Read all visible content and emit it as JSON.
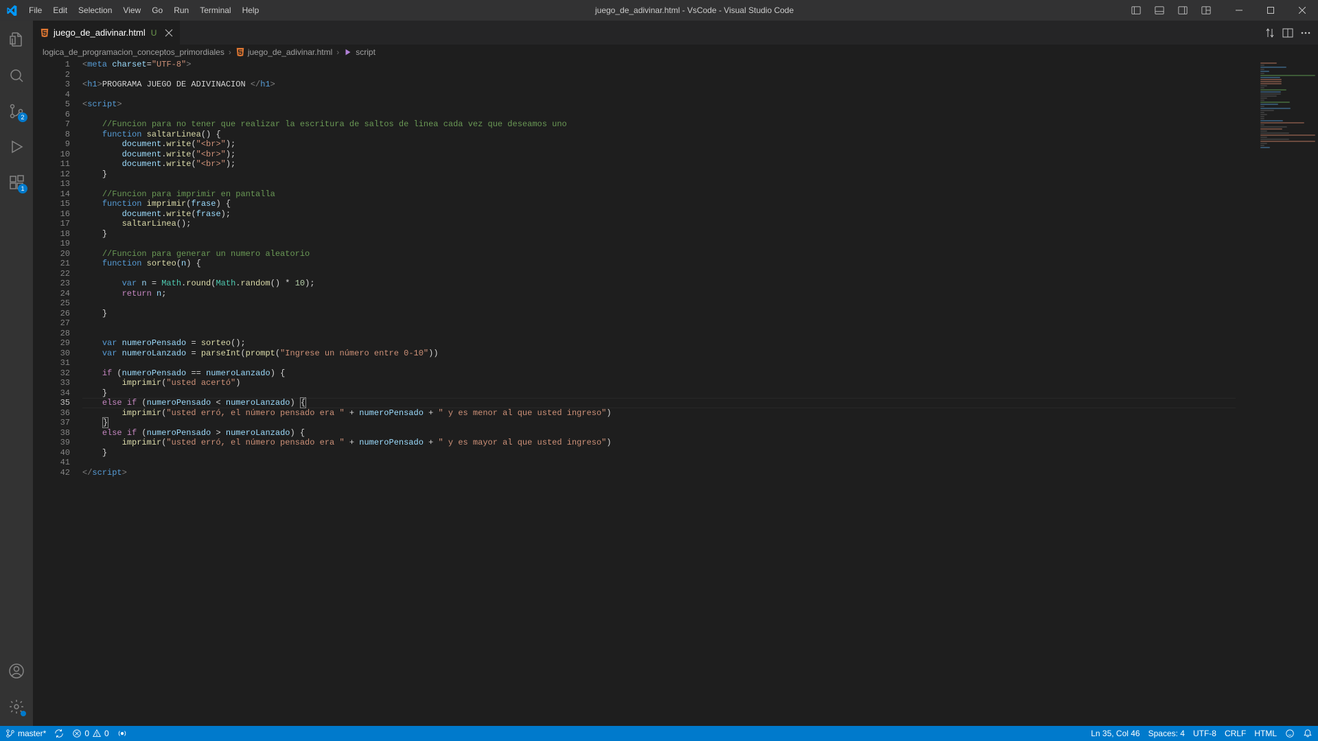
{
  "menu": [
    "File",
    "Edit",
    "Selection",
    "View",
    "Go",
    "Run",
    "Terminal",
    "Help"
  ],
  "title": "juego_de_adivinar.html - VsCode - Visual Studio Code",
  "tab": {
    "name": "juego_de_adivinar.html",
    "modified": "U"
  },
  "breadcrumbs": {
    "folder": "logica_de_programacion_conceptos_primordiales",
    "file": "juego_de_adivinar.html",
    "symbol": "script"
  },
  "activity": {
    "scm_badge": "2",
    "ext_badge": "1"
  },
  "code_lines": [
    [
      {
        "c": "m-tag",
        "t": "<"
      },
      {
        "c": "m-name",
        "t": "meta"
      },
      {
        "c": "m-text",
        "t": " "
      },
      {
        "c": "m-attr",
        "t": "charset"
      },
      {
        "c": "m-op",
        "t": "="
      },
      {
        "c": "m-str",
        "t": "\"UTF-8\""
      },
      {
        "c": "m-tag",
        "t": ">"
      }
    ],
    [],
    [
      {
        "c": "m-tag",
        "t": "<"
      },
      {
        "c": "m-name",
        "t": "h1"
      },
      {
        "c": "m-tag",
        "t": ">"
      },
      {
        "c": "m-text",
        "t": "PROGRAMA JUEGO DE ADIVINACION "
      },
      {
        "c": "m-tag",
        "t": "</"
      },
      {
        "c": "m-name",
        "t": "h1"
      },
      {
        "c": "m-tag",
        "t": ">"
      }
    ],
    [],
    [
      {
        "c": "m-tag",
        "t": "<"
      },
      {
        "c": "m-name",
        "t": "script"
      },
      {
        "c": "m-tag",
        "t": ">"
      }
    ],
    [],
    [
      {
        "c": "m-text",
        "t": "    "
      },
      {
        "c": "m-comment",
        "t": "//Funcion para no tener que realizar la escritura de saltos de linea cada vez que deseamos uno"
      }
    ],
    [
      {
        "c": "m-text",
        "t": "    "
      },
      {
        "c": "m-kw",
        "t": "function"
      },
      {
        "c": "m-text",
        "t": " "
      },
      {
        "c": "m-fn",
        "t": "saltarLinea"
      },
      {
        "c": "m-paren",
        "t": "() {"
      }
    ],
    [
      {
        "c": "m-text",
        "t": "        "
      },
      {
        "c": "m-var",
        "t": "document"
      },
      {
        "c": "m-op",
        "t": "."
      },
      {
        "c": "m-fn",
        "t": "write"
      },
      {
        "c": "m-paren",
        "t": "("
      },
      {
        "c": "m-str",
        "t": "\"<br>\""
      },
      {
        "c": "m-paren",
        "t": ");"
      }
    ],
    [
      {
        "c": "m-text",
        "t": "        "
      },
      {
        "c": "m-var",
        "t": "document"
      },
      {
        "c": "m-op",
        "t": "."
      },
      {
        "c": "m-fn",
        "t": "write"
      },
      {
        "c": "m-paren",
        "t": "("
      },
      {
        "c": "m-str",
        "t": "\"<br>\""
      },
      {
        "c": "m-paren",
        "t": ");"
      }
    ],
    [
      {
        "c": "m-text",
        "t": "        "
      },
      {
        "c": "m-var",
        "t": "document"
      },
      {
        "c": "m-op",
        "t": "."
      },
      {
        "c": "m-fn",
        "t": "write"
      },
      {
        "c": "m-paren",
        "t": "("
      },
      {
        "c": "m-str",
        "t": "\"<br>\""
      },
      {
        "c": "m-paren",
        "t": ");"
      }
    ],
    [
      {
        "c": "m-text",
        "t": "    "
      },
      {
        "c": "m-paren",
        "t": "}"
      }
    ],
    [],
    [
      {
        "c": "m-text",
        "t": "    "
      },
      {
        "c": "m-comment",
        "t": "//Funcion para imprimir en pantalla"
      }
    ],
    [
      {
        "c": "m-text",
        "t": "    "
      },
      {
        "c": "m-kw",
        "t": "function"
      },
      {
        "c": "m-text",
        "t": " "
      },
      {
        "c": "m-fn",
        "t": "imprimir"
      },
      {
        "c": "m-paren",
        "t": "("
      },
      {
        "c": "m-var",
        "t": "frase"
      },
      {
        "c": "m-paren",
        "t": ") {"
      }
    ],
    [
      {
        "c": "m-text",
        "t": "        "
      },
      {
        "c": "m-var",
        "t": "document"
      },
      {
        "c": "m-op",
        "t": "."
      },
      {
        "c": "m-fn",
        "t": "write"
      },
      {
        "c": "m-paren",
        "t": "("
      },
      {
        "c": "m-var",
        "t": "frase"
      },
      {
        "c": "m-paren",
        "t": ");"
      }
    ],
    [
      {
        "c": "m-text",
        "t": "        "
      },
      {
        "c": "m-fn",
        "t": "saltarLinea"
      },
      {
        "c": "m-paren",
        "t": "();"
      }
    ],
    [
      {
        "c": "m-text",
        "t": "    "
      },
      {
        "c": "m-paren",
        "t": "}"
      }
    ],
    [],
    [
      {
        "c": "m-text",
        "t": "    "
      },
      {
        "c": "m-comment",
        "t": "//Funcion para generar un numero aleatorio"
      }
    ],
    [
      {
        "c": "m-text",
        "t": "    "
      },
      {
        "c": "m-kw",
        "t": "function"
      },
      {
        "c": "m-text",
        "t": " "
      },
      {
        "c": "m-fn",
        "t": "sorteo"
      },
      {
        "c": "m-paren",
        "t": "("
      },
      {
        "c": "m-var",
        "t": "n"
      },
      {
        "c": "m-paren",
        "t": ") {"
      }
    ],
    [],
    [
      {
        "c": "m-text",
        "t": "        "
      },
      {
        "c": "m-kw",
        "t": "var"
      },
      {
        "c": "m-text",
        "t": " "
      },
      {
        "c": "m-var",
        "t": "n"
      },
      {
        "c": "m-text",
        "t": " = "
      },
      {
        "c": "m-obj",
        "t": "Math"
      },
      {
        "c": "m-op",
        "t": "."
      },
      {
        "c": "m-fn",
        "t": "round"
      },
      {
        "c": "m-paren",
        "t": "("
      },
      {
        "c": "m-obj",
        "t": "Math"
      },
      {
        "c": "m-op",
        "t": "."
      },
      {
        "c": "m-fn",
        "t": "random"
      },
      {
        "c": "m-paren",
        "t": "()"
      },
      {
        "c": "m-text",
        "t": " * "
      },
      {
        "c": "m-num",
        "t": "10"
      },
      {
        "c": "m-paren",
        "t": ");"
      }
    ],
    [
      {
        "c": "m-text",
        "t": "        "
      },
      {
        "c": "m-kw2",
        "t": "return"
      },
      {
        "c": "m-text",
        "t": " "
      },
      {
        "c": "m-var",
        "t": "n"
      },
      {
        "c": "m-paren",
        "t": ";"
      }
    ],
    [],
    [
      {
        "c": "m-text",
        "t": "    "
      },
      {
        "c": "m-paren",
        "t": "}"
      }
    ],
    [],
    [],
    [
      {
        "c": "m-text",
        "t": "    "
      },
      {
        "c": "m-kw",
        "t": "var"
      },
      {
        "c": "m-text",
        "t": " "
      },
      {
        "c": "m-var",
        "t": "numeroPensado"
      },
      {
        "c": "m-text",
        "t": " = "
      },
      {
        "c": "m-fn",
        "t": "sorteo"
      },
      {
        "c": "m-paren",
        "t": "();"
      }
    ],
    [
      {
        "c": "m-text",
        "t": "    "
      },
      {
        "c": "m-kw",
        "t": "var"
      },
      {
        "c": "m-text",
        "t": " "
      },
      {
        "c": "m-var",
        "t": "numeroLanzado"
      },
      {
        "c": "m-text",
        "t": " = "
      },
      {
        "c": "m-fn",
        "t": "parseInt"
      },
      {
        "c": "m-paren",
        "t": "("
      },
      {
        "c": "m-fn",
        "t": "prompt"
      },
      {
        "c": "m-paren",
        "t": "("
      },
      {
        "c": "m-str",
        "t": "\"Ingrese un número entre 0-10\""
      },
      {
        "c": "m-paren",
        "t": "))"
      }
    ],
    [],
    [
      {
        "c": "m-text",
        "t": "    "
      },
      {
        "c": "m-kw2",
        "t": "if"
      },
      {
        "c": "m-text",
        "t": " ("
      },
      {
        "c": "m-var",
        "t": "numeroPensado"
      },
      {
        "c": "m-text",
        "t": " == "
      },
      {
        "c": "m-var",
        "t": "numeroLanzado"
      },
      {
        "c": "m-paren",
        "t": ") {"
      }
    ],
    [
      {
        "c": "m-text",
        "t": "        "
      },
      {
        "c": "m-fn",
        "t": "imprimir"
      },
      {
        "c": "m-paren",
        "t": "("
      },
      {
        "c": "m-str",
        "t": "\"usted acertó\""
      },
      {
        "c": "m-paren",
        "t": ")"
      }
    ],
    [
      {
        "c": "m-text",
        "t": "    "
      },
      {
        "c": "m-paren",
        "t": "}"
      }
    ],
    [
      {
        "c": "m-text",
        "t": "    "
      },
      {
        "c": "m-kw2",
        "t": "else"
      },
      {
        "c": "m-text",
        "t": " "
      },
      {
        "c": "m-kw2",
        "t": "if"
      },
      {
        "c": "m-text",
        "t": " ("
      },
      {
        "c": "m-var",
        "t": "numeroPensado"
      },
      {
        "c": "m-text",
        "t": " < "
      },
      {
        "c": "m-var",
        "t": "numeroLanzado"
      },
      {
        "c": "m-paren",
        "t": ") "
      },
      {
        "c": "m-bracket-hl",
        "t": "{"
      }
    ],
    [
      {
        "c": "m-text",
        "t": "        "
      },
      {
        "c": "m-fn",
        "t": "imprimir"
      },
      {
        "c": "m-paren",
        "t": "("
      },
      {
        "c": "m-str",
        "t": "\"usted erró, el número pensado era \""
      },
      {
        "c": "m-text",
        "t": " + "
      },
      {
        "c": "m-var",
        "t": "numeroPensado"
      },
      {
        "c": "m-text",
        "t": " + "
      },
      {
        "c": "m-str",
        "t": "\" y es menor al que usted ingreso\""
      },
      {
        "c": "m-paren",
        "t": ")"
      }
    ],
    [
      {
        "c": "m-text",
        "t": "    "
      },
      {
        "c": "m-bracket-hl",
        "t": "}"
      }
    ],
    [
      {
        "c": "m-text",
        "t": "    "
      },
      {
        "c": "m-kw2",
        "t": "else"
      },
      {
        "c": "m-text",
        "t": " "
      },
      {
        "c": "m-kw2",
        "t": "if"
      },
      {
        "c": "m-text",
        "t": " ("
      },
      {
        "c": "m-var",
        "t": "numeroPensado"
      },
      {
        "c": "m-text",
        "t": " > "
      },
      {
        "c": "m-var",
        "t": "numeroLanzado"
      },
      {
        "c": "m-paren",
        "t": ") {"
      }
    ],
    [
      {
        "c": "m-text",
        "t": "        "
      },
      {
        "c": "m-fn",
        "t": "imprimir"
      },
      {
        "c": "m-paren",
        "t": "("
      },
      {
        "c": "m-str",
        "t": "\"usted erró, el número pensado era \""
      },
      {
        "c": "m-text",
        "t": " + "
      },
      {
        "c": "m-var",
        "t": "numeroPensado"
      },
      {
        "c": "m-text",
        "t": " + "
      },
      {
        "c": "m-str",
        "t": "\" y es mayor al que usted ingreso\""
      },
      {
        "c": "m-paren",
        "t": ")"
      }
    ],
    [
      {
        "c": "m-text",
        "t": "    "
      },
      {
        "c": "m-paren",
        "t": "}"
      }
    ],
    [],
    [
      {
        "c": "m-tag",
        "t": "</"
      },
      {
        "c": "m-name",
        "t": "script"
      },
      {
        "c": "m-tag",
        "t": ">"
      }
    ]
  ],
  "current_line": 35,
  "status": {
    "branch": "master*",
    "sync": "",
    "errors": "0",
    "warnings": "0",
    "cursor": "Ln 35, Col 46",
    "spaces": "Spaces: 4",
    "encoding": "UTF-8",
    "eol": "CRLF",
    "lang": "HTML"
  }
}
